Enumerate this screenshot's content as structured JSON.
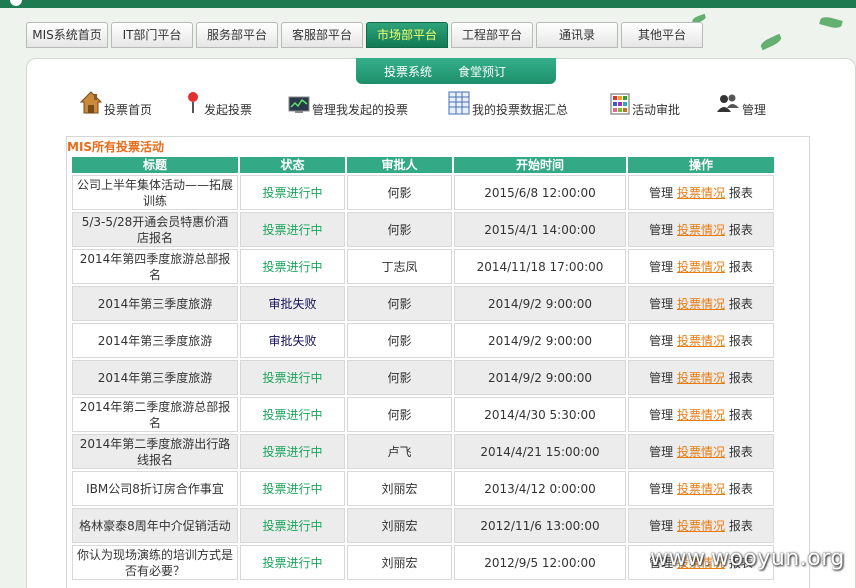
{
  "nav": {
    "tabs": [
      {
        "label": "MIS系统首页",
        "active": false
      },
      {
        "label": "IT部门平台",
        "active": false
      },
      {
        "label": "服务部平台",
        "active": false
      },
      {
        "label": "客服部平台",
        "active": false
      },
      {
        "label": "市场部平台",
        "active": true
      },
      {
        "label": "工程部平台",
        "active": false
      },
      {
        "label": "通讯录",
        "active": false
      },
      {
        "label": "其他平台",
        "active": false
      }
    ]
  },
  "subnav": {
    "items": [
      "投票系统",
      "食堂预订"
    ]
  },
  "toolbar": {
    "items": [
      {
        "label": "投票首页",
        "icon": "home-icon"
      },
      {
        "label": "发起投票",
        "icon": "map-pin-icon"
      },
      {
        "label": "管理我发起的投票",
        "icon": "monitor-chart-icon"
      },
      {
        "label": "我的投票数据汇总",
        "icon": "spreadsheet-icon"
      },
      {
        "label": "活动审批",
        "icon": "color-grid-icon"
      },
      {
        "label": "管理",
        "icon": "users-icon"
      }
    ]
  },
  "section": {
    "title": "MIS所有投票活动"
  },
  "table": {
    "headers": [
      "标题",
      "状态",
      "审批人",
      "开始时间",
      "操作"
    ],
    "ops": {
      "manage": "管理",
      "result": "投票情况",
      "report": "报表"
    },
    "rows": [
      {
        "title": "公司上半年集体活动——拓展训练",
        "status": "投票进行中",
        "status_type": "ongoing",
        "approver": "何影",
        "start": "2015/6/8 12:00:00"
      },
      {
        "title": "5/3-5/28开通会员特惠价酒店报名",
        "status": "投票进行中",
        "status_type": "ongoing",
        "approver": "何影",
        "start": "2015/4/1 14:00:00"
      },
      {
        "title": "2014年第四季度旅游总部报名",
        "status": "投票进行中",
        "status_type": "ongoing",
        "approver": "丁志凤",
        "start": "2014/11/18 17:00:00"
      },
      {
        "title": "2014年第三季度旅游",
        "status": "审批失败",
        "status_type": "failed",
        "approver": "何影",
        "start": "2014/9/2 9:00:00"
      },
      {
        "title": "2014年第三季度旅游",
        "status": "审批失败",
        "status_type": "failed",
        "approver": "何影",
        "start": "2014/9/2 9:00:00"
      },
      {
        "title": "2014年第三季度旅游",
        "status": "投票进行中",
        "status_type": "ongoing",
        "approver": "何影",
        "start": "2014/9/2 9:00:00"
      },
      {
        "title": "2014年第二季度旅游总部报名",
        "status": "投票进行中",
        "status_type": "ongoing",
        "approver": "何影",
        "start": "2014/4/30 5:30:00"
      },
      {
        "title": "2014年第二季度旅游出行路线报名",
        "status": "投票进行中",
        "status_type": "ongoing",
        "approver": "卢飞",
        "start": "2014/4/21 15:00:00"
      },
      {
        "title": "IBM公司8折订房合作事宜",
        "status": "投票进行中",
        "status_type": "ongoing",
        "approver": "刘丽宏",
        "start": "2013/4/12 0:00:00"
      },
      {
        "title": "格林豪泰8周年中介促销活动",
        "status": "投票进行中",
        "status_type": "ongoing",
        "approver": "刘丽宏",
        "start": "2012/11/6 13:00:00"
      },
      {
        "title": "你认为现场演练的培训方式是否有必要？",
        "status": "投票进行中",
        "status_type": "ongoing",
        "approver": "刘丽宏",
        "start": "2012/9/5 12:00:00"
      }
    ]
  },
  "watermark": "www.wooyun.org",
  "colors": {
    "header_green": "#33a985",
    "active_tab": "#127a55",
    "link_orange": "#e87b10",
    "status_green": "#1aa55a",
    "status_fail": "#10105a"
  }
}
